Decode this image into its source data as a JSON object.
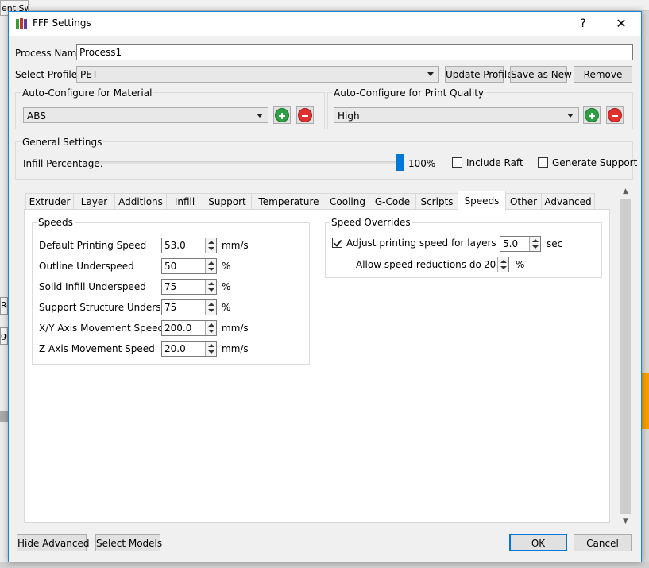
{
  "background": {
    "fragment_top": "ent Sw",
    "fragment_re": "Re",
    "fragment_ge": "ge"
  },
  "window": {
    "title": "FFF Settings",
    "help": "?",
    "close": "✕"
  },
  "process": {
    "name_label": "Process Name:",
    "name_value": "Process1",
    "profile_label": "Select Profile:",
    "profile_value": "PET"
  },
  "profile_buttons": {
    "update": "Update Profile",
    "save_new": "Save as New",
    "remove": "Remove"
  },
  "material": {
    "title": "Auto-Configure for Material",
    "value": "ABS"
  },
  "quality": {
    "title": "Auto-Configure for Print Quality",
    "value": "High"
  },
  "general": {
    "title": "General Settings",
    "infill_label": "Infill Percentage:",
    "infill_value": "100%",
    "infill_fraction": 1.0,
    "raft_label": "Include Raft",
    "raft_checked": false,
    "support_label": "Generate Support",
    "support_checked": false
  },
  "tabs": [
    "Extruder",
    "Layer",
    "Additions",
    "Infill",
    "Support",
    "Temperature",
    "Cooling",
    "G-Code",
    "Scripts",
    "Speeds",
    "Other",
    "Advanced"
  ],
  "active_tab": "Speeds",
  "speeds": {
    "title": "Speeds",
    "rows": [
      {
        "label": "Default Printing Speed",
        "value": "53.0",
        "unit": "mm/s"
      },
      {
        "label": "Outline Underspeed",
        "value": "50",
        "unit": "%"
      },
      {
        "label": "Solid Infill Underspeed",
        "value": "75",
        "unit": "%"
      },
      {
        "label": "Support Structure Underspeed",
        "value": "75",
        "unit": "%"
      },
      {
        "label": "X/Y Axis Movement Speed",
        "value": "200.0",
        "unit": "mm/s"
      },
      {
        "label": "Z Axis Movement Speed",
        "value": "20.0",
        "unit": "mm/s"
      }
    ]
  },
  "overrides": {
    "title": "Speed Overrides",
    "adjust_label": "Adjust printing speed for layers below",
    "adjust_checked": true,
    "adjust_value": "5.0",
    "adjust_unit": "sec",
    "reduce_label": "Allow speed reductions down to",
    "reduce_value": "20",
    "reduce_unit": "%"
  },
  "footer": {
    "hide_advanced": "Hide Advanced",
    "select_models": "Select Models",
    "ok": "OK",
    "cancel": "Cancel"
  },
  "colors": {
    "accent": "#1883d7",
    "add": "#2ea043",
    "remove": "#e03030"
  }
}
